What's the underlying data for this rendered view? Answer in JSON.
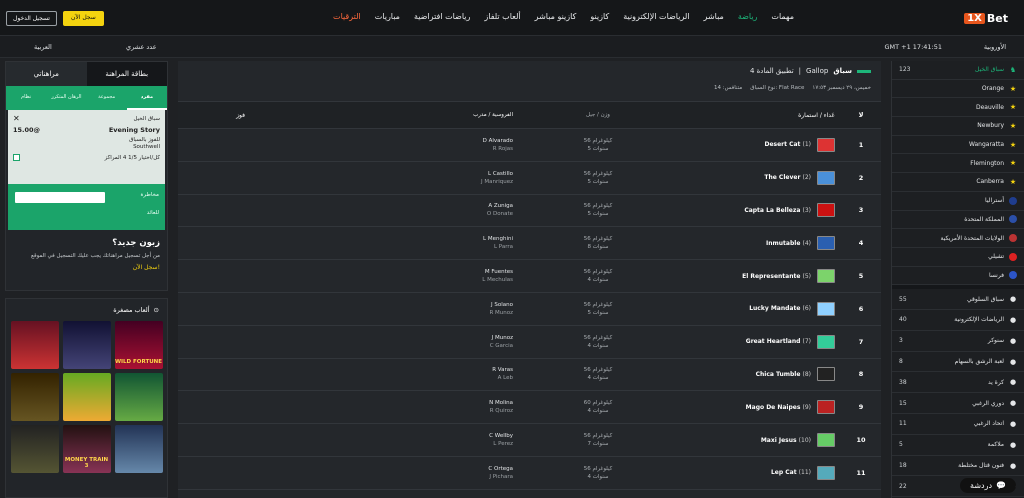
{
  "header": {
    "nav": [
      "مهمات",
      "رياضة",
      "مباشر",
      "الرياضات الإلكترونية",
      "كازينو",
      "كازينو مباشر",
      "ألعاب تلفاز",
      "رياضات افتراضية",
      "مباريات",
      "الترقيات"
    ],
    "register": "سجل الآن",
    "login": "تسجيل الدخول"
  },
  "subbar": {
    "timezone": "GMT +1 17:41:51",
    "format": "الأوروبية",
    "odds_format": "عدد عشري",
    "language": "العربية"
  },
  "betslip": {
    "tab_card": "بطاقة المراهنة",
    "tab_my": "مراهناتي",
    "sub_tabs": [
      "مفرد",
      "مجموعة",
      "الرهان المتكرر",
      "نظام"
    ],
    "event_label": "سباق الخيل",
    "selection": "Evening Story",
    "odds": "15.00@",
    "market_label": "للفوز بالسباق",
    "track": "Southwell",
    "ew_label": "كل/اختيار 1/5 4 المراكز",
    "stake_label": "مخاطرة",
    "return_label": "للعائد",
    "new_title": "زبون جديد؟",
    "new_text": "من أجل تسجيل مراهناتك يجب عليك التسجيل في الموقع",
    "new_link": "سجل الآن!"
  },
  "games": {
    "title": "ألعاب مصغرة",
    "tiles": [
      "",
      "",
      "WILD FORTUNE",
      "",
      "",
      "",
      "",
      "MONEY TRAIN 3",
      ""
    ]
  },
  "event": {
    "title": "سباق",
    "provider": "Gallop",
    "race_app": "تطبيق المادة 4",
    "meta": [
      "خميس، ٢٩ ديسمبر ١٧:٥٣",
      "نوع السباق: Flat Race",
      "متنافس: 14"
    ],
    "headers": {
      "no": "لا",
      "horse": "عَداء / استمارة",
      "wt": "وزن / جيل",
      "jockey": "الفروسية / مدرب",
      "win": "فوز"
    },
    "runners": [
      {
        "no": "1",
        "name": "Desert Cat",
        "num": "(1)",
        "wt": "56 كيلوغرام",
        "age": "5 سنوات",
        "jockey": "D Alvarado",
        "trainer": "R Rojas",
        "silk": "#d33"
      },
      {
        "no": "2",
        "name": "The Clever",
        "num": "(2)",
        "wt": "56 كيلوغرام",
        "age": "5 سنوات",
        "jockey": "L Castillo",
        "trainer": "J Manriquez",
        "silk": "#4a90d9"
      },
      {
        "no": "3",
        "name": "Capta La Belleza",
        "num": "(3)",
        "wt": "56 كيلوغرام",
        "age": "5 سنوات",
        "jockey": "A Zuniga",
        "trainer": "O Donate",
        "silk": "#c11"
      },
      {
        "no": "4",
        "name": "Inmutable",
        "num": "(4)",
        "wt": "56 كيلوغرام",
        "age": "8 سنوات",
        "jockey": "L Menghini",
        "trainer": "L Parra",
        "silk": "#2a5fb0"
      },
      {
        "no": "5",
        "name": "El Representante",
        "num": "(5)",
        "wt": "56 كيلوغرام",
        "age": "4 سنوات",
        "jockey": "M Fuentes",
        "trainer": "L Mechulas",
        "silk": "#7cd36b"
      },
      {
        "no": "6",
        "name": "Lucky Mandate",
        "num": "(6)",
        "wt": "56 كيلوغرام",
        "age": "5 سنوات",
        "jockey": "J Solano",
        "trainer": "R Munoz",
        "silk": "#8fd0ff"
      },
      {
        "no": "7",
        "name": "Great Heartland",
        "num": "(7)",
        "wt": "56 كيلوغرام",
        "age": "4 سنوات",
        "jockey": "J Munoz",
        "trainer": "C Garcia",
        "silk": "#3c9"
      },
      {
        "no": "8",
        "name": "Chica Tumble",
        "num": "(8)",
        "wt": "56 كيلوغرام",
        "age": "4 سنوات",
        "jockey": "R Varas",
        "trainer": "A Leb",
        "silk": "#222"
      },
      {
        "no": "9",
        "name": "Mago De Naipes",
        "num": "(9)",
        "wt": "60 كيلوغرام",
        "age": "4 سنوات",
        "jockey": "N Molina",
        "trainer": "R Quiroz",
        "silk": "#b22"
      },
      {
        "no": "10",
        "name": "Maxi Jesus",
        "num": "(10)",
        "wt": "56 كيلوغرام",
        "age": "7 سنوات",
        "jockey": "C Wellby",
        "trainer": "L Perez",
        "silk": "#6c6"
      },
      {
        "no": "11",
        "name": "Lep Cat",
        "num": "(11)",
        "wt": "56 كيلوغرام",
        "age": "4 سنوات",
        "jockey": "C Ortega",
        "trainer": "J Pichara",
        "silk": "#5ab"
      }
    ]
  },
  "sidebar": [
    {
      "label": "سباق الخيل",
      "count": "123",
      "icon": "horse-icon",
      "head": true
    },
    {
      "label": "Orange",
      "count": "",
      "icon": "star-icon"
    },
    {
      "label": "Deauville",
      "count": "",
      "icon": "star-icon"
    },
    {
      "label": "Newbury",
      "count": "",
      "icon": "star-icon"
    },
    {
      "label": "Wangaratta",
      "count": "",
      "icon": "star-icon"
    },
    {
      "label": "Flemington",
      "count": "",
      "icon": "star-icon"
    },
    {
      "label": "Canberra",
      "count": "",
      "icon": "star-icon"
    },
    {
      "label": "أستراليا",
      "count": "",
      "icon": "flag-icon",
      "color": "#1f3d8f"
    },
    {
      "label": "المملكة المتحدة",
      "count": "",
      "icon": "flag-icon",
      "color": "#2b4fa8"
    },
    {
      "label": "الولايات المتحدة الأمريكية",
      "count": "",
      "icon": "flag-icon",
      "color": "#b33"
    },
    {
      "label": "تشيلي",
      "count": "",
      "icon": "flag-icon",
      "color": "#d22"
    },
    {
      "label": "فرنسا",
      "count": "",
      "icon": "flag-icon",
      "color": "#2c55c8"
    }
  ],
  "sports": [
    {
      "label": "سباق السلوقي",
      "count": "55",
      "icon": "greyhound-icon"
    },
    {
      "label": "الرياضات الإلكترونية",
      "count": "40",
      "icon": "gamepad-icon"
    },
    {
      "label": "سنوكر",
      "count": "3",
      "icon": "snooker-icon"
    },
    {
      "label": "لعبة الرشق بالسهام",
      "count": "8",
      "icon": "darts-icon"
    },
    {
      "label": "كرة يد",
      "count": "38",
      "icon": "handball-icon"
    },
    {
      "label": "دوري الرغبي",
      "count": "15",
      "icon": "rugby-icon"
    },
    {
      "label": "اتحاد الرغبي",
      "count": "11",
      "icon": "rugby-union-icon"
    },
    {
      "label": "ملاكمة",
      "count": "5",
      "icon": "boxing-icon"
    },
    {
      "label": "فنون قتال مختلطة",
      "count": "18",
      "icon": "mma-icon"
    },
    {
      "label": "",
      "count": "22",
      "icon": "sport-icon"
    }
  ],
  "chat": "دردشة"
}
